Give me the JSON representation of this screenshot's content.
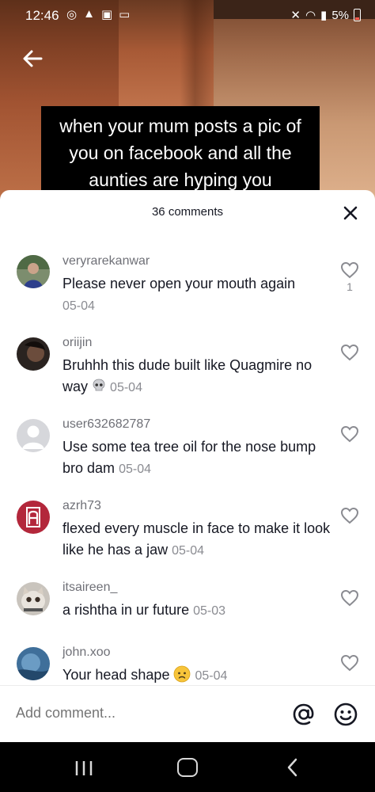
{
  "status_bar": {
    "time": "12:46",
    "battery": "5%",
    "battery_color": "#ff5a4f"
  },
  "video": {
    "caption": "when your mum posts a pic of you on facebook and all the aunties are hyping you"
  },
  "comments_sheet": {
    "count_label": "36 comments",
    "comments": [
      {
        "username": "veryrarekanwar",
        "text": "Please never open your mouth again",
        "date": "05-04",
        "likes": "1",
        "avatar": "boy-photo"
      },
      {
        "username": "oriijin",
        "text": "Bruhhh this dude built like Quagmire no way",
        "emoji": "skull",
        "date": "05-04",
        "likes": "",
        "avatar": "dark-photo"
      },
      {
        "username": "user632682787",
        "text": "Use some tea tree oil for the nose bump bro dam",
        "date": "05-04",
        "likes": "",
        "avatar": "default-avatar"
      },
      {
        "username": "azrh73",
        "text": "flexed every muscle in face to make it look like he has a jaw",
        "date": "05-04",
        "likes": "",
        "avatar": "letter-a-logo"
      },
      {
        "username": "itsaireen_",
        "text": "a rishtha in ur future",
        "date": "05-03",
        "likes": "",
        "avatar": "cat-photo"
      },
      {
        "username": "john.xoo",
        "text": "Your head shape",
        "emoji": "worried-face",
        "date": "05-04",
        "likes": "",
        "avatar": "blue-photo"
      }
    ]
  },
  "input": {
    "placeholder": "Add comment..."
  },
  "colors": {
    "sheet_bg": "#ffffff",
    "text_primary": "#161823",
    "text_secondary": "#8a8b91"
  }
}
